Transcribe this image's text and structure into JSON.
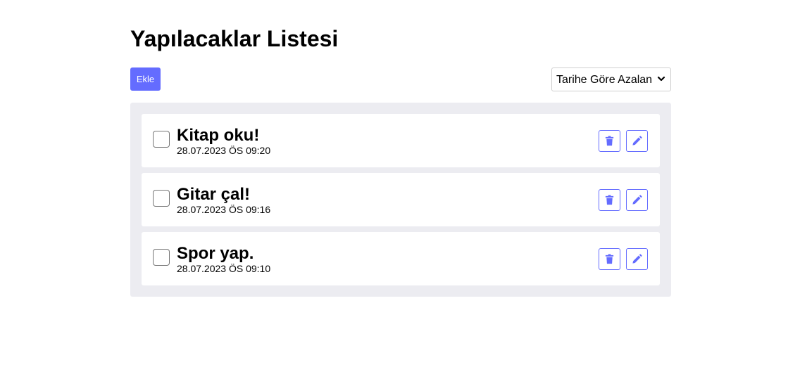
{
  "header": {
    "title": "Yapılacaklar Listesi"
  },
  "toolbar": {
    "add_label": "Ekle",
    "sort_selected": "Tarihe Göre Azalan"
  },
  "todos": [
    {
      "title": "Kitap oku!",
      "date": "28.07.2023 ÖS 09:20",
      "completed": false
    },
    {
      "title": "Gitar çal!",
      "date": "28.07.2023 ÖS 09:16",
      "completed": false
    },
    {
      "title": "Spor yap.",
      "date": "28.07.2023 ÖS 09:10",
      "completed": false
    }
  ],
  "icons": {
    "delete": "trash-icon",
    "edit": "pencil-icon",
    "sort": "chevron-down-icon"
  },
  "colors": {
    "accent": "#646cff",
    "panel_background": "#ececf1",
    "item_background": "#ffffff"
  }
}
